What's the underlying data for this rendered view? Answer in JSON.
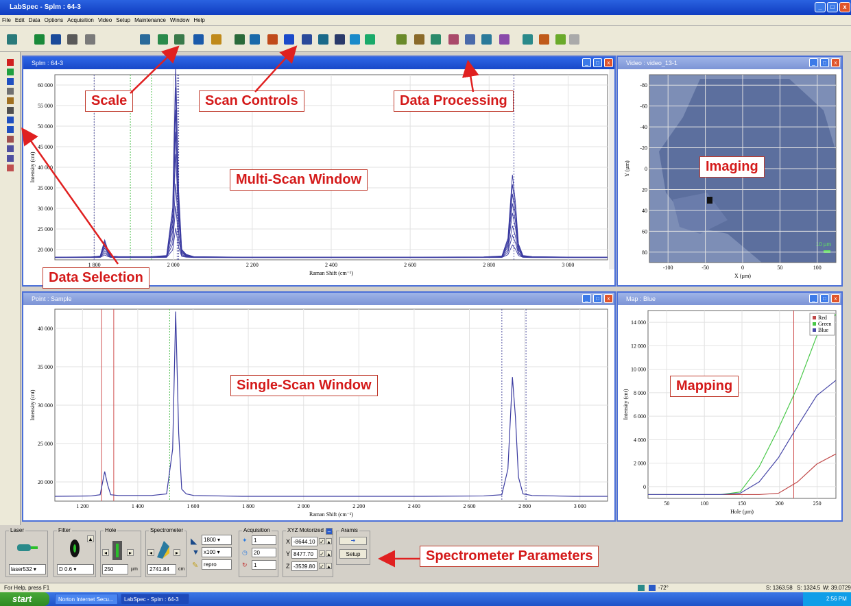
{
  "app": {
    "title": "LabSpec - Splm : 64-3"
  },
  "menu": [
    "File",
    "Edit",
    "Data",
    "Options",
    "Acquisition",
    "Video",
    "Setup",
    "Maintenance",
    "Window",
    "Help"
  ],
  "windows": {
    "multi": {
      "title": "Splm : 64-3"
    },
    "video": {
      "title": "Video : video_13-1"
    },
    "point": {
      "title": "Point : Sample"
    },
    "map": {
      "title": "Map : Blue"
    }
  },
  "multi_plot": {
    "ylabel": "Intensity (cnt)",
    "xlabel": "Raman Shift (cm⁻¹)",
    "yticks": [
      "60 000",
      "55 000",
      "50 000",
      "45 000",
      "40 000",
      "35 000",
      "30 000",
      "25 000",
      "20 000"
    ],
    "xticks": [
      "1 800",
      "2 000",
      "2 200",
      "2 400",
      "2 600",
      "2 800",
      "3 000"
    ]
  },
  "single_plot": {
    "ylabel": "Intensity (cnt)",
    "xlabel": "Raman Shift (cm⁻¹)",
    "yticks": [
      "40 000",
      "35 000",
      "30 000",
      "25 000",
      "20 000"
    ],
    "xticks": [
      "1 200",
      "1 400",
      "1 600",
      "1 800",
      "2 000",
      "2 200",
      "2 400",
      "2 600",
      "2 800",
      "3 000"
    ]
  },
  "video_plot": {
    "ylabel": "Y (µm)",
    "xlabel": "X (µm)",
    "yticks": [
      "-80",
      "-60",
      "-40",
      "-20",
      "0",
      "20",
      "40",
      "60",
      "80"
    ],
    "xticks": [
      "-100",
      "-50",
      "0",
      "50",
      "100"
    ],
    "scale_label": "10 µm"
  },
  "chart_data": [
    {
      "type": "line",
      "title": "",
      "xlabel": "Raman Shift (cm⁻¹)",
      "ylabel": "Intensity (cnt)",
      "ylim": [
        19500,
        43500
      ],
      "xlim": [
        1180,
        3010
      ],
      "x": [
        1180,
        1300,
        1330,
        1345,
        1355,
        1365,
        1390,
        1500,
        1550,
        1570,
        1580,
        1590,
        1600,
        1615,
        1640,
        1800,
        2000,
        2200,
        2400,
        2600,
        2660,
        2680,
        2695,
        2705,
        2715,
        2730,
        2760,
        2900,
        3010
      ],
      "series": [
        {
          "color": "#3a3aa0",
          "values": [
            20100,
            20150,
            20300,
            23200,
            21500,
            20300,
            20200,
            20200,
            20400,
            26000,
            43200,
            28000,
            21000,
            20400,
            20200,
            20100,
            20100,
            20100,
            20100,
            20150,
            20300,
            23500,
            35000,
            30000,
            22500,
            20400,
            20200,
            20100,
            20100
          ]
        }
      ]
    },
    {
      "type": "line",
      "title": "",
      "xlabel": "Hole (µm)",
      "ylabel": "Intensity (cnt)",
      "ylim": [
        -300,
        14500
      ],
      "xlim": [
        5,
        250
      ],
      "x": [
        5,
        50,
        100,
        125,
        150,
        175,
        200,
        225,
        250
      ],
      "legend": [
        "Red",
        "Green",
        "Blue"
      ],
      "legend_position": "top-right",
      "series": [
        {
          "name": "Red",
          "color": "#c04848",
          "values": [
            0,
            0,
            0,
            0,
            0,
            100,
            1000,
            2400,
            3200
          ]
        },
        {
          "name": "Green",
          "color": "#48c848",
          "values": [
            0,
            0,
            0,
            200,
            2200,
            5200,
            8500,
            12500,
            14200
          ]
        },
        {
          "name": "Blue",
          "color": "#4848a8",
          "values": [
            0,
            0,
            0,
            100,
            1000,
            2900,
            5400,
            7800,
            9000
          ]
        }
      ]
    }
  ],
  "map_plot": {
    "yticks": [
      "14 000",
      "12 000",
      "10 000",
      "8 000",
      "6 000",
      "4 000",
      "2 000",
      "0"
    ],
    "xticks": [
      "50",
      "100",
      "150",
      "200",
      "250"
    ]
  },
  "callouts": {
    "scale": "Scale",
    "scan_controls": "Scan Controls",
    "data_processing": "Data Processing",
    "multi_scan": "Multi-Scan Window",
    "imaging": "Imaging",
    "data_selection": "Data Selection",
    "single_scan": "Single-Scan Window",
    "mapping": "Mapping",
    "spectrometer": "Spectrometer Parameters"
  },
  "params": {
    "laser": {
      "label": "Laser",
      "value": "laser532"
    },
    "filter": {
      "label": "Filter",
      "value": "D 0.6"
    },
    "hole": {
      "label": "Hole",
      "value": "250",
      "unit": "µm"
    },
    "spectrometer": {
      "label": "Spectrometer",
      "value": "2741.84",
      "unit": "cm"
    },
    "grating": "1800",
    "objective": "x100",
    "repro": "repro",
    "acquisition": {
      "label": "Acquisition",
      "time": "1",
      "accum": "20",
      "cycles": "1"
    },
    "xyz": {
      "label": "XYZ Motorized",
      "x_label": "X",
      "x": "-8644.10",
      "y_label": "Y",
      "y": "8477.70",
      "z_label": "Z",
      "z": "-3539.80"
    },
    "aramis": {
      "label": "Aramis",
      "setup": "Setup"
    }
  },
  "status": {
    "help": "For Help, press F1",
    "temp": "-72°",
    "s1": "S: 1363.58",
    "s2": "S: 1324.5",
    "w": "W: 39.0729"
  },
  "taskbar": {
    "start": "start",
    "tasks": [
      "Norton Internet Secu...",
      "LabSpec - Splm : 64-3"
    ],
    "clock": "2:56 PM"
  }
}
